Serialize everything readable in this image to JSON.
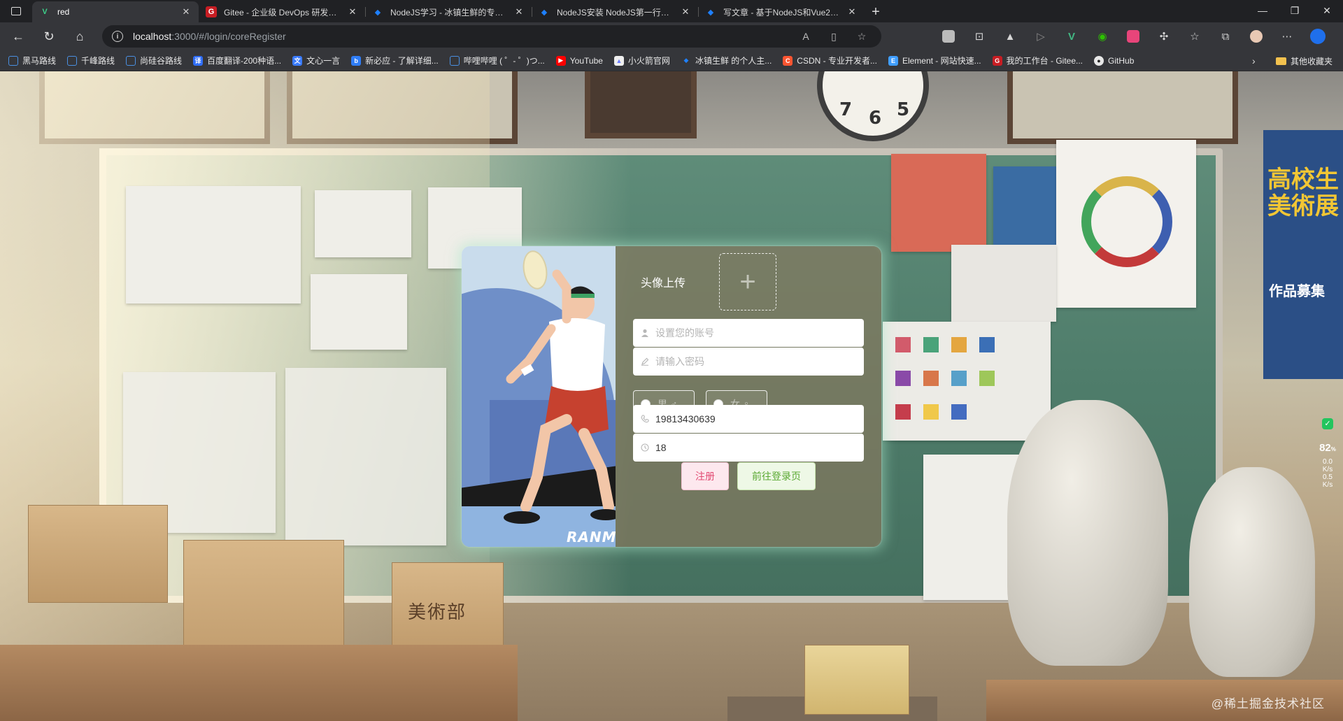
{
  "browser": {
    "tabs": [
      {
        "label": "red",
        "favicon": "v-logo-icon",
        "color": "#3cd18a",
        "active": true
      },
      {
        "label": "Gitee - 企业级 DevOps 研发效能",
        "favicon": "gitee-icon",
        "color": "#c71d23",
        "active": false
      },
      {
        "label": "NodeJS学习 - 冰镇生鲜的专栏 - 掘金",
        "favicon": "juejin-icon",
        "color": "#1e80ff",
        "active": false
      },
      {
        "label": "NodeJS安装 NodeJS第一行代码",
        "favicon": "juejin-icon",
        "color": "#1e80ff",
        "active": false
      },
      {
        "label": "写文章 - 基于NodeJS和Vue2实现",
        "favicon": "juejin-icon",
        "color": "#1e80ff",
        "active": false
      }
    ],
    "url_host": "localhost",
    "url_path": ":3000/#/login/coreRegister",
    "bookmarks": [
      {
        "label": "黑马路线",
        "icon": "folder-cloud-icon",
        "color": "#4a90e2"
      },
      {
        "label": "千峰路线",
        "icon": "folder-cloud-icon",
        "color": "#4a90e2"
      },
      {
        "label": "尚硅谷路线",
        "icon": "folder-cloud-icon",
        "color": "#4a90e2"
      },
      {
        "label": "百度翻译-200种语...",
        "icon": "baidu-translate-icon",
        "color": "#2f6df6"
      },
      {
        "label": "文心一言",
        "icon": "wenxin-icon",
        "color": "#3a7bfd"
      },
      {
        "label": "新必应 - 了解详细...",
        "icon": "bing-icon",
        "color": "#2f7df6"
      },
      {
        "label": "哔哩哔哩 ( ゜- ゜)つ...",
        "icon": "folder-cloud-icon",
        "color": "#4a90e2"
      },
      {
        "label": "YouTube",
        "icon": "youtube-icon",
        "color": "#ff0000"
      },
      {
        "label": "小火箭官网",
        "icon": "rocket-icon",
        "color": "#6b7cff"
      },
      {
        "label": "冰镇生鲜 的个人主...",
        "icon": "juejin-icon",
        "color": "#1e80ff"
      },
      {
        "label": "CSDN - 专业开发者...",
        "icon": "csdn-icon",
        "color": "#fc5531"
      },
      {
        "label": "Element - 网站快速...",
        "icon": "element-icon",
        "color": "#409eff"
      },
      {
        "label": "我的工作台 - Gitee...",
        "icon": "gitee-icon",
        "color": "#c71d23"
      },
      {
        "label": "GitHub",
        "icon": "github-icon",
        "color": "#e8e8e8"
      }
    ],
    "other_bookmarks": "其他收藏夹"
  },
  "background": {
    "box_label": "美術部",
    "poster_title": "高校生\n美術展",
    "poster_sub": "作品募集",
    "clock_numbers": [
      "7",
      "6",
      "5"
    ],
    "watermark": "@稀土掘金技术社区"
  },
  "net_widget": {
    "percent": "82",
    "percent_unit": "%",
    "up": "0.0",
    "up_unit": "K/s",
    "down": "0.5",
    "down_unit": "K/s"
  },
  "register": {
    "avatar_label": "头像上传",
    "avatar_plus": "+",
    "account_placeholder": "设置您的账号",
    "password_placeholder": "请输入密码",
    "gender_male": "男 ♂",
    "gender_female": "女 ♀",
    "phone_value": "19813430639",
    "age_value": "18",
    "register_button": "注册",
    "goto_login_button": "前往登录页",
    "illustration_text": "RANM"
  }
}
